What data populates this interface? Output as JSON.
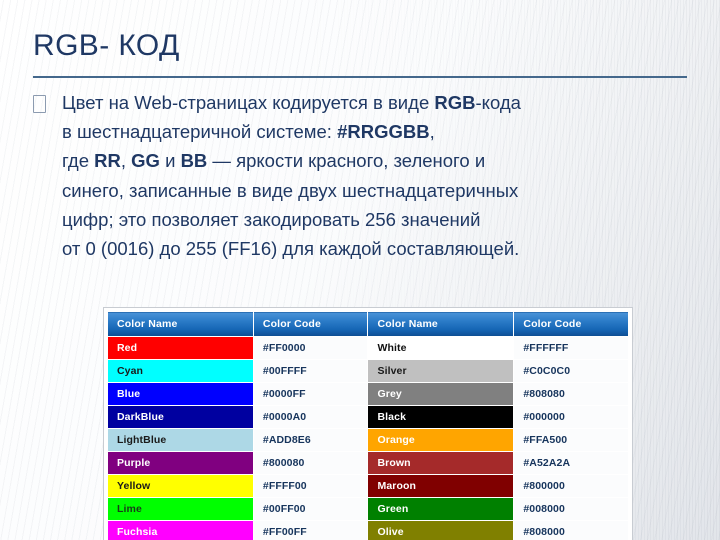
{
  "slide": {
    "title": "RGB- КОД",
    "title_color": "#1f3864",
    "rule_color": "#44688c",
    "body": {
      "bullet_glyph": "hollow-rectangle-bullet",
      "lines": [
        [
          {
            "t": "Цвет на Web-страницах кодируется в виде ",
            "b": false
          },
          {
            "t": "RGB",
            "b": true
          },
          {
            "t": "-кода",
            "b": false
          }
        ],
        [
          {
            "t": "в шестнадцатеричной системе: ",
            "b": false
          },
          {
            "t": "#RRGGBB",
            "b": true
          },
          {
            "t": ",",
            "b": false
          }
        ],
        [
          {
            "t": "где ",
            "b": false
          },
          {
            "t": "RR",
            "b": true
          },
          {
            "t": ", ",
            "b": false
          },
          {
            "t": "GG",
            "b": true
          },
          {
            "t": " и ",
            "b": false
          },
          {
            "t": "BB",
            "b": true
          },
          {
            "t": " — яркости красного, зеленого и",
            "b": false
          }
        ],
        [
          {
            "t": "синего, записанные в виде двух шестнадцатеричных",
            "b": false
          }
        ],
        [
          {
            "t": "цифр; это позволяет закодировать 256 значений",
            "b": false
          }
        ],
        [
          {
            "t": "от 0 (0016) до 255 (FF16) для каждой составляющей.",
            "b": false
          }
        ]
      ]
    }
  },
  "table": {
    "headers": [
      "Color Name",
      "Color Code",
      "Color Name",
      "Color Code"
    ],
    "header_bg": "#1565b4",
    "rows": [
      {
        "left": {
          "name": "Red",
          "code": "#FF0000",
          "swatch": "#FF0000",
          "text": "#FFFFFF"
        },
        "right": {
          "name": "White",
          "code": "#FFFFFF",
          "swatch": "#FFFFFF",
          "text": "#111111"
        }
      },
      {
        "left": {
          "name": "Cyan",
          "code": "#00FFFF",
          "swatch": "#00FFFF",
          "text": "#1a1a1a"
        },
        "right": {
          "name": "Silver",
          "code": "#C0C0C0",
          "swatch": "#C0C0C0",
          "text": "#1a1a1a"
        }
      },
      {
        "left": {
          "name": "Blue",
          "code": "#0000FF",
          "swatch": "#0000FF",
          "text": "#FFFFFF"
        },
        "right": {
          "name": "Grey",
          "code": "#808080",
          "swatch": "#808080",
          "text": "#FFFFFF"
        }
      },
      {
        "left": {
          "name": "DarkBlue",
          "code": "#0000A0",
          "swatch": "#0000A0",
          "text": "#FFFFFF"
        },
        "right": {
          "name": "Black",
          "code": "#000000",
          "swatch": "#000000",
          "text": "#FFFFFF"
        }
      },
      {
        "left": {
          "name": "LightBlue",
          "code": "#ADD8E6",
          "swatch": "#ADD8E6",
          "text": "#1a1a1a"
        },
        "right": {
          "name": "Orange",
          "code": "#FFA500",
          "swatch": "#FFA500",
          "text": "#FFFFFF"
        }
      },
      {
        "left": {
          "name": "Purple",
          "code": "#800080",
          "swatch": "#800080",
          "text": "#FFFFFF"
        },
        "right": {
          "name": "Brown",
          "code": "#A52A2A",
          "swatch": "#A52A2A",
          "text": "#FFFFFF"
        }
      },
      {
        "left": {
          "name": "Yellow",
          "code": "#FFFF00",
          "swatch": "#FFFF00",
          "text": "#1a1a1a"
        },
        "right": {
          "name": "Maroon",
          "code": "#800000",
          "swatch": "#800000",
          "text": "#FFFFFF"
        }
      },
      {
        "left": {
          "name": "Lime",
          "code": "#00FF00",
          "swatch": "#00FF00",
          "text": "#1a3a1a"
        },
        "right": {
          "name": "Green",
          "code": "#008000",
          "swatch": "#008000",
          "text": "#FFFFFF"
        }
      },
      {
        "left": {
          "name": "Fuchsia",
          "code": "#FF00FF",
          "swatch": "#FF00FF",
          "text": "#FFFFFF"
        },
        "right": {
          "name": "Olive",
          "code": "#808000",
          "swatch": "#808000",
          "text": "#FFFFFF"
        }
      }
    ]
  }
}
